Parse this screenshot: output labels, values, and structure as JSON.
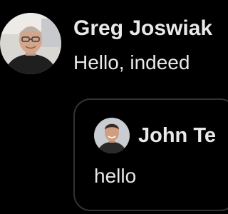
{
  "post": {
    "author_name": "Greg Joswiak",
    "text": "Hello, indeed",
    "avatar_icon": "user-avatar-icon"
  },
  "quote": {
    "author_name": "John Te",
    "text": "hello",
    "avatar_icon": "user-avatar-icon"
  },
  "colors": {
    "background": "#000000",
    "text": "#e7e9ea",
    "border": "#2f3336"
  }
}
